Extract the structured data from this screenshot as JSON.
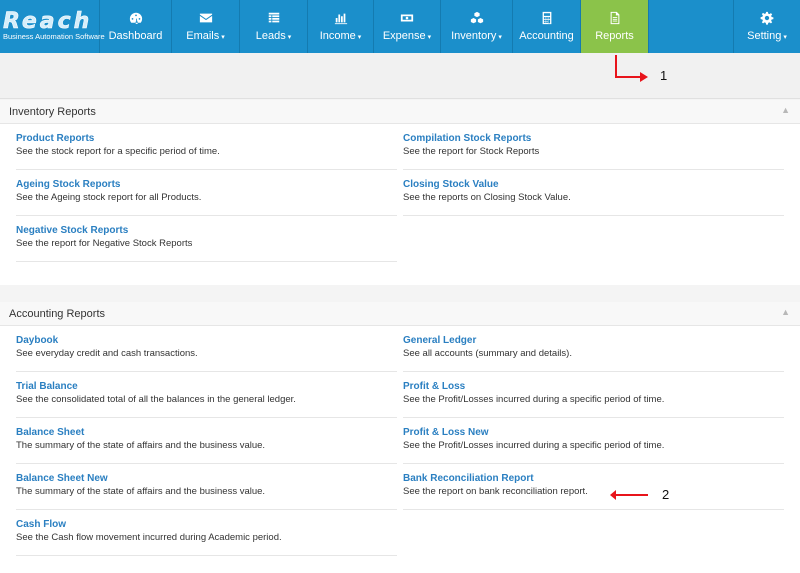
{
  "logo": {
    "wordmark": "Reach",
    "tagline": "Business Automation Software"
  },
  "nav": {
    "dashboard": "Dashboard",
    "emails": "Emails",
    "leads": "Leads",
    "income": "Income",
    "expense": "Expense",
    "inventory": "Inventory",
    "accounting": "Accounting",
    "reports": "Reports",
    "setting": "Setting",
    "caret": "▾"
  },
  "inventory_reports": {
    "heading": "Inventory Reports",
    "items": [
      {
        "title": "Product Reports",
        "desc": "See the stock report for a specific period of time."
      },
      {
        "title": "Compilation Stock Reports",
        "desc": "See the report for Stock Reports"
      },
      {
        "title": "Ageing Stock Reports",
        "desc": "See the Ageing stock report for all Products."
      },
      {
        "title": "Closing Stock Value",
        "desc": "See the reports on Closing Stock Value."
      },
      {
        "title": "Negative Stock Reports",
        "desc": "See the report for Negative Stock Reports"
      }
    ]
  },
  "accounting_reports": {
    "heading": "Accounting Reports",
    "items": [
      {
        "title": "Daybook",
        "desc": "See everyday credit and cash transactions."
      },
      {
        "title": "General Ledger",
        "desc": "See all accounts (summary and details)."
      },
      {
        "title": "Trial Balance",
        "desc": "See the consolidated total of all the balances in the general ledger."
      },
      {
        "title": "Profit & Loss",
        "desc": "See the Profit/Losses incurred during a specific period of time."
      },
      {
        "title": "Balance Sheet",
        "desc": "The summary of the state of affairs and the business value."
      },
      {
        "title": "Profit & Loss New",
        "desc": "See the Profit/Losses incurred during a specific period of time."
      },
      {
        "title": "Balance Sheet New",
        "desc": "The summary of the state of affairs and the business value."
      },
      {
        "title": "Bank Reconciliation Report",
        "desc": "See the report on bank reconciliation report."
      },
      {
        "title": "Cash Flow",
        "desc": "See the Cash flow movement incurred during Academic period."
      }
    ]
  },
  "annotations": {
    "one": "1",
    "two": "2"
  },
  "colors": {
    "nav_bg": "#1b8fcb",
    "active_bg": "#8bc34a",
    "link": "#2a7fc1",
    "annotation": "#e8141b"
  }
}
